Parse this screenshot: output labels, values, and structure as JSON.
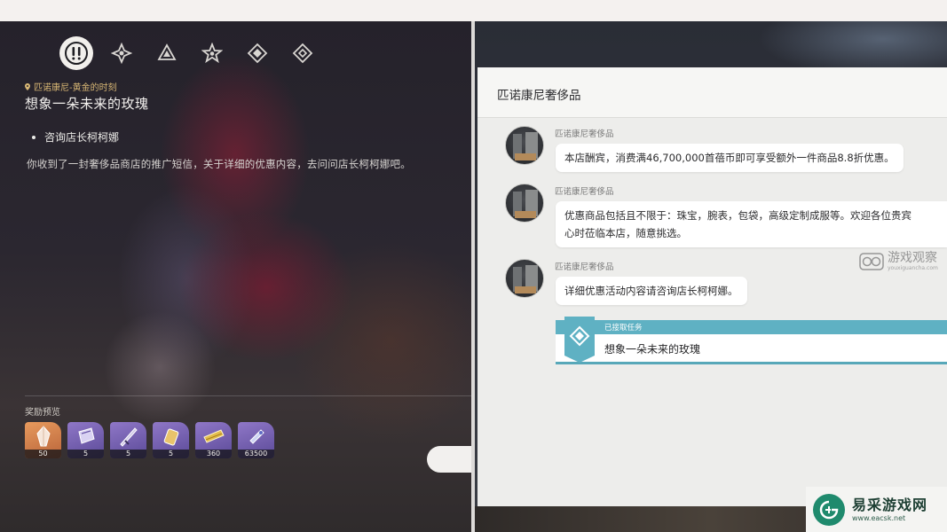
{
  "left": {
    "location": "匹诺康尼-黄金的时刻",
    "quest_title": "想象一朵未来的玫瑰",
    "objective": "咨询店长柯柯娜",
    "description": "你收到了一封奢侈品商店的推广短信，关于详细的优惠内容，去问问店长柯柯娜吧。",
    "tabs": [
      {
        "icon": "exclamation-icon",
        "active": true
      },
      {
        "icon": "diamond-star-icon"
      },
      {
        "icon": "triangle-icon"
      },
      {
        "icon": "star-icon"
      },
      {
        "icon": "rhombus-icon"
      },
      {
        "icon": "diamond-icon"
      }
    ],
    "reward_label": "奖励预览",
    "rewards": [
      {
        "icon": "crystal-icon",
        "count": "50",
        "color": "#e08d55"
      },
      {
        "icon": "purple-book-icon",
        "count": "5",
        "color": "#7e68bb"
      },
      {
        "icon": "sword-material-icon",
        "count": "5",
        "color": "#7e68bb"
      },
      {
        "icon": "gold-material-icon",
        "count": "5",
        "color": "#7e68bb"
      },
      {
        "icon": "credit-icon",
        "count": "360",
        "color": "#7e68bb"
      },
      {
        "icon": "exp-book-icon",
        "count": "63500",
        "color": "#7e68bb"
      }
    ]
  },
  "right": {
    "header": "匹诺康尼奢侈品",
    "messages": [
      {
        "sender": "匹诺康尼奢侈品",
        "lines": [
          "本店酬宾，消费满46,700,000首蓓币即可享受额外一件商品8.8折优惠。"
        ]
      },
      {
        "sender": "匹诺康尼奢侈品",
        "lines": [
          "优惠商品包括且不限于：珠宝，腕表，包袋，高级定制成服等。欢迎各位贵宾",
          "心时莅临本店，随意挑选。"
        ]
      },
      {
        "sender": "匹诺康尼奢侈品",
        "lines": [
          "详细优惠活动内容请咨询店长柯柯娜。"
        ]
      }
    ],
    "accepted": {
      "label": "已接取任务",
      "title": "想象一朵未来的玫瑰"
    }
  },
  "watermark": {
    "cn": "游戏观察",
    "en": "youxiguancha.com"
  },
  "logo": {
    "cn": "易采游戏网",
    "en": "www.eacsk.net"
  },
  "colors": {
    "accent_teal": "#5fb1c3",
    "location_gold": "#d8b774",
    "logo_green": "#1f8a6d"
  }
}
